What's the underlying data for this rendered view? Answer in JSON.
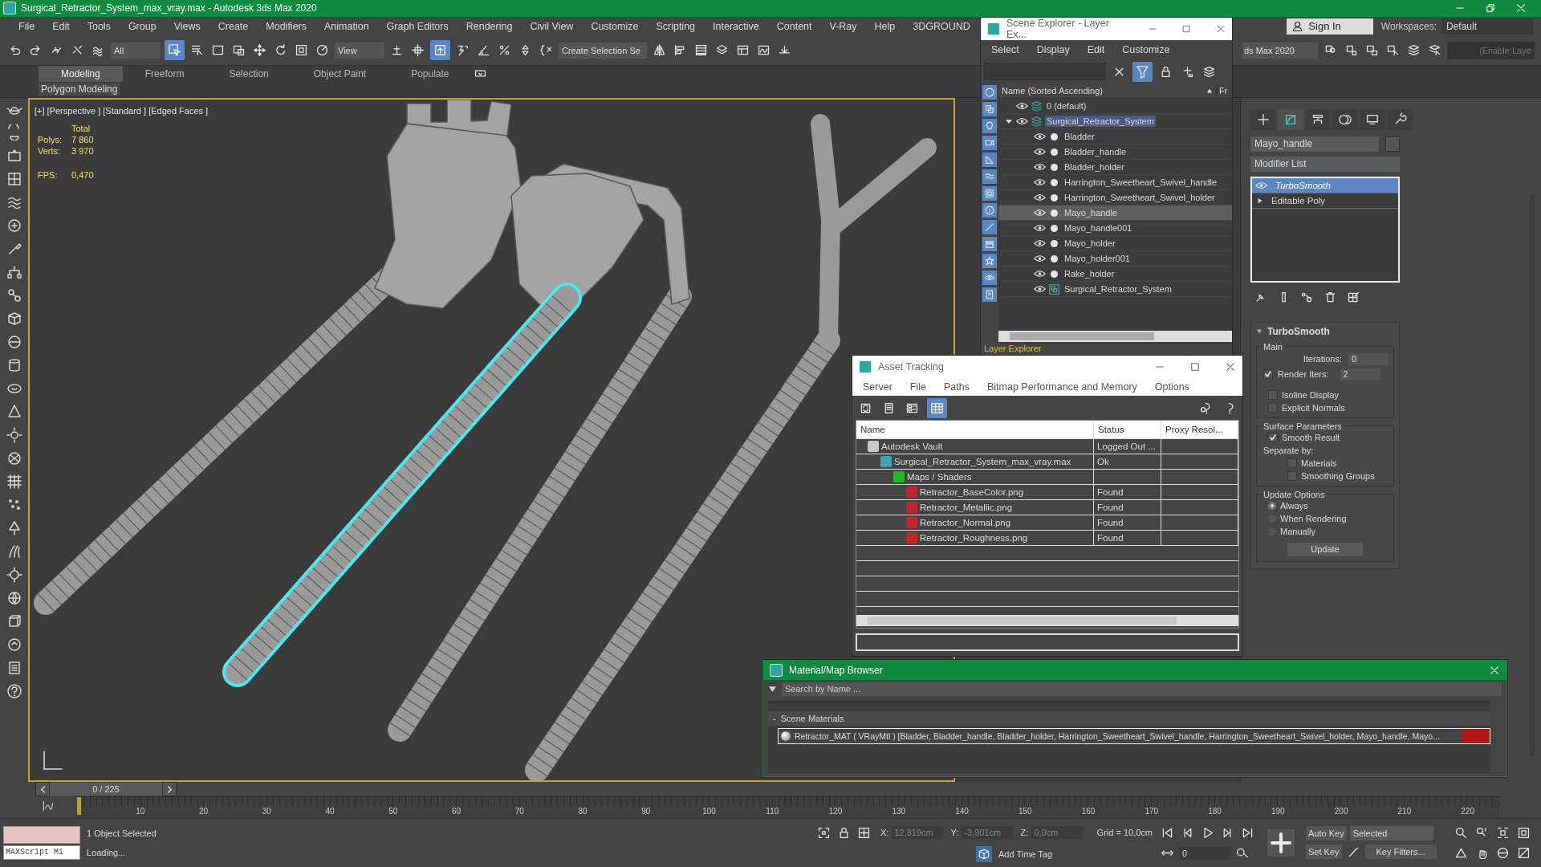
{
  "window": {
    "title": "Surgical_Retractor_System_max_vray.max - Autodesk 3ds Max 2020"
  },
  "menu": [
    "File",
    "Edit",
    "Tools",
    "Group",
    "Views",
    "Create",
    "Modifiers",
    "Animation",
    "Graph Editors",
    "Rendering",
    "Civil View",
    "Customize",
    "Scripting",
    "Interactive",
    "Content",
    "V-Ray",
    "Help",
    "3DGROUND"
  ],
  "account": {
    "sign_in": "Sign In",
    "workspaces_label": "Workspaces:",
    "workspace": "Default"
  },
  "toolbar": {
    "selection_filter": "All",
    "reference_coordinate": "View",
    "selection_set": "Create Selection Se",
    "project": "ds Max 2020",
    "layer_field": "(Enable Laye"
  },
  "ribbon": {
    "tabs": [
      {
        "label": "Modeling",
        "selected": true
      },
      {
        "label": "Freeform",
        "selected": false
      },
      {
        "label": "Selection",
        "selected": false
      },
      {
        "label": "Object Paint",
        "selected": false
      },
      {
        "label": "Populate",
        "selected": false
      }
    ],
    "panel": "Polygon Modeling"
  },
  "viewport": {
    "label": "[+] [Perspective ] [Standard ] [Edged Faces ]",
    "total": "Total",
    "stats": [
      {
        "label": "Polys:",
        "value": "7 860"
      },
      {
        "label": "Verts:",
        "value": "3 970"
      }
    ],
    "fps": {
      "label": "FPS:",
      "value": "0,470"
    }
  },
  "scene_explorer": {
    "title": "Scene Explorer - Layer Ex...",
    "menu": [
      "Select",
      "Display",
      "Edit",
      "Customize"
    ],
    "column": "Name (Sorted Ascending)",
    "column_2": "Fr",
    "footer": "Layer Explorer",
    "tree": [
      {
        "name": "0 (default)",
        "kind": "layer",
        "selected": false
      },
      {
        "name": "Surgical_Retractor_System",
        "kind": "layer",
        "selected": true,
        "expanded": true,
        "children": [
          {
            "name": "Bladder",
            "kind": "object",
            "selected": false
          },
          {
            "name": "Bladder_handle",
            "kind": "object",
            "selected": false
          },
          {
            "name": "Bladder_holder",
            "kind": "object",
            "selected": false
          },
          {
            "name": "Harrington_Sweetheart_Swivel_handle",
            "kind": "object",
            "selected": false
          },
          {
            "name": "Harrington_Sweetheart_Swivel_holder",
            "kind": "object",
            "selected": false
          },
          {
            "name": "Mayo_handle",
            "kind": "object",
            "selected": true
          },
          {
            "name": "Mayo_handle001",
            "kind": "object",
            "selected": false
          },
          {
            "name": "Mayo_holder",
            "kind": "object",
            "selected": false
          },
          {
            "name": "Mayo_holder001",
            "kind": "object",
            "selected": false
          },
          {
            "name": "Rake_holder",
            "kind": "object",
            "selected": false
          },
          {
            "name": "Surgical_Retractor_System",
            "kind": "group",
            "selected": false
          }
        ]
      }
    ]
  },
  "command_panel": {
    "tabs": [
      {
        "kind": "create",
        "selected": false
      },
      {
        "kind": "modify",
        "selected": true
      },
      {
        "kind": "hierarchy",
        "selected": false
      },
      {
        "kind": "motion",
        "selected": false
      },
      {
        "kind": "display",
        "selected": false
      },
      {
        "kind": "utilities",
        "selected": false
      }
    ],
    "object_name": "Mayo_handle",
    "modifier_list": "Modifier List",
    "stack": [
      {
        "name": "TurboSmooth",
        "selected": true
      },
      {
        "name": "Editable Poly",
        "selected": false
      }
    ],
    "rollout": {
      "title": "TurboSmooth",
      "main": {
        "label": "Main",
        "iterations": {
          "label": "Iterations:",
          "value": "0"
        },
        "render_iters": {
          "label": "Render Iters:",
          "value": "2",
          "checked": true
        },
        "options": [
          {
            "label": "Isoline Display",
            "checked": false
          },
          {
            "label": "Explicit Normals",
            "checked": false
          }
        ]
      },
      "surface": {
        "label": "Surface Parameters",
        "smooth_result": {
          "label": "Smooth Result",
          "checked": true
        },
        "separate_label": "Separate by:",
        "separate": [
          {
            "label": "Materials",
            "checked": false
          },
          {
            "label": "Smoothing Groups",
            "checked": false
          }
        ]
      },
      "update": {
        "label": "Update Options",
        "options": [
          {
            "label": "Always",
            "selected": true
          },
          {
            "label": "When Rendering",
            "selected": false
          },
          {
            "label": "Manually",
            "selected": false
          }
        ],
        "button": "Update"
      }
    }
  },
  "asset_tracking": {
    "title": "Asset Tracking",
    "menu": [
      "Server",
      "File",
      "Paths",
      "Bitmap Performance and Memory",
      "Options"
    ],
    "view_buttons": [
      {
        "kind": "refresh",
        "selected": false
      },
      {
        "kind": "list",
        "selected": false
      },
      {
        "kind": "thumbnails",
        "selected": false
      },
      {
        "kind": "table",
        "selected": true
      }
    ],
    "columns": [
      "Name",
      "Status",
      "Proxy Resol..."
    ],
    "rows": [
      {
        "name": "Autodesk Vault",
        "status": "Logged Out ...",
        "kind": "vault",
        "children": [
          {
            "name": "Surgical_Retractor_System_max_vray.max",
            "status": "Ok",
            "kind": "scene",
            "children": [
              {
                "name": "Maps / Shaders",
                "kind": "folder",
                "children": [
                  {
                    "name": "Retractor_BaseColor.png",
                    "status": "Found",
                    "kind": "bitmap"
                  },
                  {
                    "name": "Retractor_Metallic.png",
                    "status": "Found",
                    "kind": "bitmap"
                  },
                  {
                    "name": "Retractor_Normal.png",
                    "status": "Found",
                    "kind": "bitmap"
                  },
                  {
                    "name": "Retractor_Roughness.png",
                    "status": "Found",
                    "kind": "bitmap"
                  }
                ]
              }
            ]
          }
        ]
      }
    ]
  },
  "material_browser": {
    "title": "Material/Map Browser",
    "search_placeholder": "Search by Name ...",
    "section_toggle": "-",
    "section": "Scene Materials",
    "materials": [
      "Retractor_MAT ( VRayMtl ) [Bladder, Bladder_handle, Bladder_holder, Harrington_Sweetheart_Swivel_handle, Harrington_Sweetheart_Swivel_holder, Mayo_handle, Mayo..."
    ]
  },
  "timeline": {
    "frame": "0 / 225",
    "ticks": [
      "10",
      "20",
      "30",
      "40",
      "50",
      "60",
      "70",
      "80",
      "90",
      "100",
      "110",
      "120",
      "130",
      "140",
      "150",
      "160",
      "170",
      "180",
      "190",
      "200",
      "210",
      "220"
    ]
  },
  "status_bar": {
    "maxscript": "MAXScript Mi",
    "selection": "1 Object Selected",
    "prompt": "Loading...",
    "x_label": "X:",
    "x": "12,819cm",
    "y_label": "Y:",
    "y": "-3,901cm",
    "z_label": "Z:",
    "z": "0,0cm",
    "grid": "Grid = 10,0cm",
    "add_time_tag": "Add Time Tag",
    "auto_key": "Auto Key",
    "key_mode": "Selected",
    "set_key": "Set Key",
    "key_filters": "Key Filters...",
    "frame": "0"
  }
}
